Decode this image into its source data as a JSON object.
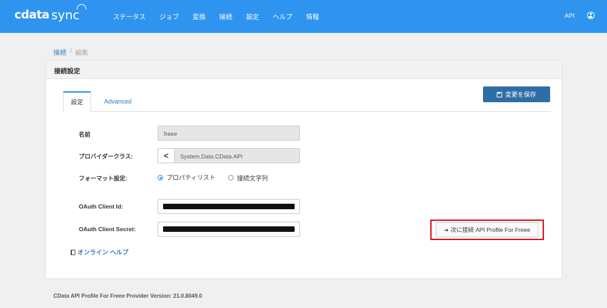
{
  "header": {
    "logo_main": "cdata",
    "logo_sub": "sync",
    "nav": [
      "ステータス",
      "ジョブ",
      "変換",
      "接続",
      "設定",
      "ヘルプ",
      "情報"
    ],
    "api": "API",
    "user_icon": "user-circle-icon"
  },
  "breadcrumb": {
    "parent": "接続",
    "separator": "/",
    "current": "編集"
  },
  "panel": {
    "title": "接続設定",
    "save_label": "変更を保存",
    "tabs": [
      "設定",
      "Advanced"
    ]
  },
  "form": {
    "name_label": "名前",
    "name_value": "freee",
    "provider_label": "プロバイダークラス:",
    "provider_value": "System.Data.CData.API",
    "format_label": "フォーマット設定:",
    "format_options": [
      "プロパティリスト",
      "接続文字列"
    ],
    "client_id_label": "OAuth Client Id:",
    "client_secret_label": "OAuth Client Secret:"
  },
  "help_link": "オンライン ヘルプ",
  "connect_button": "次に接続 API Profile For Freee",
  "footer": "CData API Profile For Freee Provider Version: 21.0.8049.0",
  "colors": {
    "topbar": "#2e94f0",
    "save_button": "#2f6ea5",
    "highlight": "#e0141e"
  }
}
